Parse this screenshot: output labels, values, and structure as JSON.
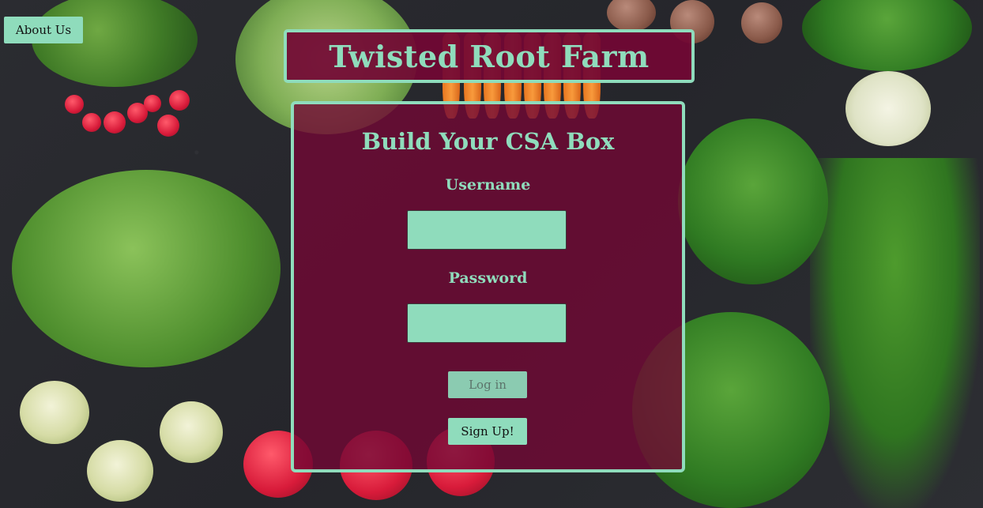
{
  "app": {
    "title": "Twisted Root Farm"
  },
  "nav": {
    "about_label": "About Us"
  },
  "login_panel": {
    "heading": "Build Your CSA Box",
    "username_label": "Username",
    "username_value": "",
    "password_label": "Password",
    "password_value": "",
    "login_button": "Log in",
    "signup_button": "Sign Up!"
  },
  "colors": {
    "accent": "#8fdcbc",
    "panel_background": "#720834",
    "page_background": "#2a2b30"
  },
  "background": {
    "description_icon": "vegetables-background-image"
  }
}
